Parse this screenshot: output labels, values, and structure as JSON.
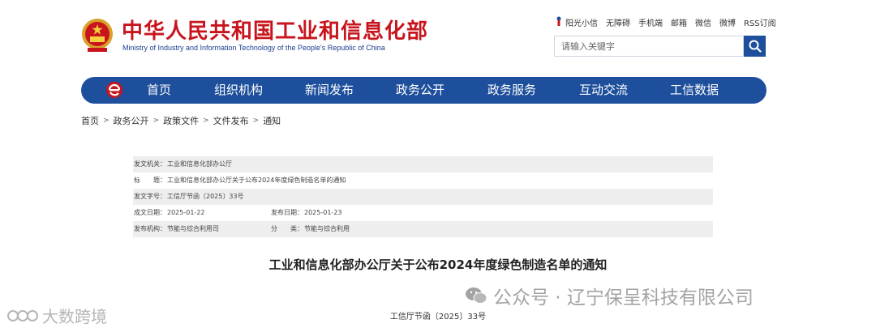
{
  "colors": {
    "brand_red": "#c8151d",
    "brand_blue": "#1d4f9c",
    "row_shade": "#eeeeee"
  },
  "header": {
    "title_cn": "中华人民共和国工业和信息化部",
    "title_en": "Ministry of Industry and Information Technology of the People's Republic of China",
    "emblem_icon": "national-emblem-icon",
    "top_links": [
      "阳光小信",
      "无障碍",
      "手机端",
      "邮箱",
      "微信",
      "微博",
      "RSS订阅"
    ],
    "search": {
      "placeholder": "请输入关键字",
      "icon": "search-icon"
    }
  },
  "nav": {
    "logo_icon": "miit-logo-icon",
    "items": [
      "首页",
      "组织机构",
      "新闻发布",
      "政务公开",
      "政务服务",
      "互动交流",
      "工信数据"
    ]
  },
  "breadcrumb": {
    "items": [
      "首页",
      "政务公开",
      "政策文件",
      "文件发布",
      "通知"
    ],
    "separator": ">"
  },
  "info": {
    "issuer_label": "发文机关：",
    "issuer": "工业和信息化部办公厅",
    "title_label": "标　　题：",
    "title": "工业和信息化部办公厅关于公布2024年度绿色制造名单的通知",
    "doc_no_label": "发文字号：",
    "doc_no": "工信厅节函〔2025〕33号",
    "date_label": "成文日期：",
    "date": "2025-01-22",
    "pub_date_label": "发布日期：",
    "pub_date": "2025-01-23",
    "org_label": "发布机构：",
    "org": "节能与综合利用司",
    "category_label": "分　　类：",
    "category": "节能与综合利用"
  },
  "article": {
    "title": "工业和信息化部办公厅关于公布2024年度绿色制造名单的通知",
    "doc_number": "工信厅节函〔2025〕33号"
  },
  "watermarks": {
    "right": "公众号 · 辽宁保呈科技有限公司",
    "left": "大数跨境"
  }
}
